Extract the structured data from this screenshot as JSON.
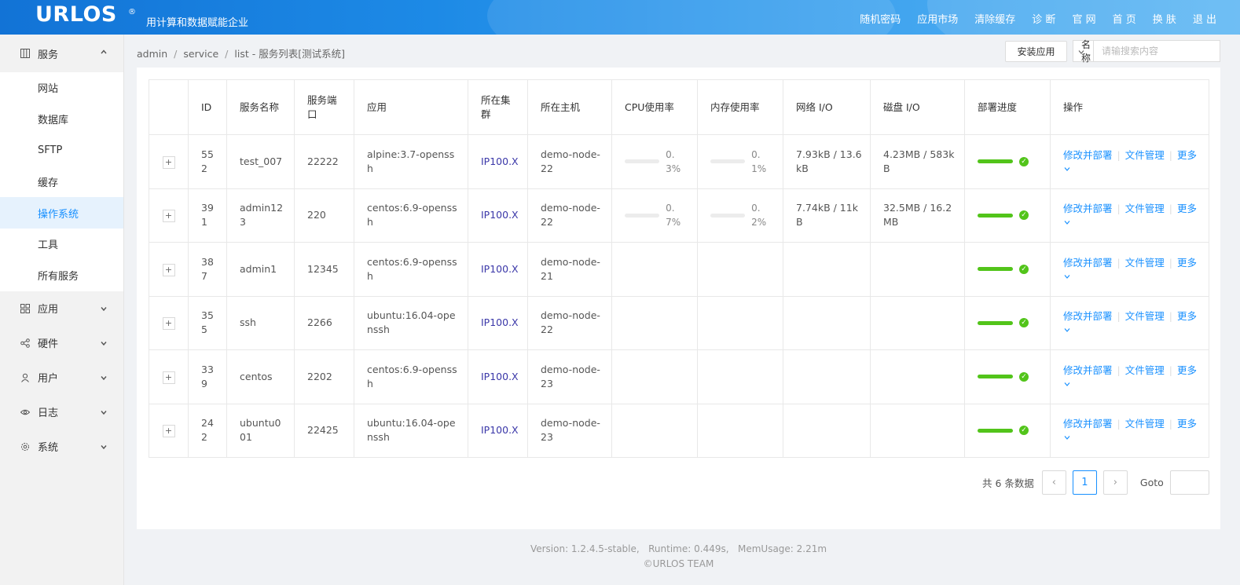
{
  "header": {
    "logo": "URLOS",
    "logo_mark": "®",
    "slogan": "用计算和数据赋能企业",
    "nav": [
      "随机密码",
      "应用市场",
      "清除缓存",
      "诊 断",
      "官 网",
      "首 页",
      "换 肤",
      "退 出"
    ]
  },
  "sidebar": {
    "groups": [
      {
        "label": "服务",
        "icon": "grid-icon",
        "expanded": true,
        "items": [
          "网站",
          "数据库",
          "SFTP",
          "缓存",
          "操作系统",
          "工具",
          "所有服务"
        ],
        "active_item": "操作系统"
      },
      {
        "label": "应用",
        "icon": "apps-icon",
        "expanded": false
      },
      {
        "label": "硬件",
        "icon": "share-icon",
        "expanded": false
      },
      {
        "label": "用户",
        "icon": "user-icon",
        "expanded": false
      },
      {
        "label": "日志",
        "icon": "eye-icon",
        "expanded": false
      },
      {
        "label": "系统",
        "icon": "gear-icon",
        "expanded": false
      }
    ]
  },
  "breadcrumb": {
    "parts": [
      "admin",
      "service",
      "list"
    ],
    "tail": "服务列表[测试系统]"
  },
  "toolbar": {
    "install_label": "安装应用",
    "search_field": "名称",
    "search_placeholder": "请输搜索内容"
  },
  "table": {
    "columns": [
      "ID",
      "服务名称",
      "服务端口",
      "应用",
      "所在集群",
      "所在主机",
      "CPU使用率",
      "内存使用率",
      "网络 I/O",
      "磁盘 I/O",
      "部署进度",
      "操作"
    ],
    "rows": [
      {
        "id": "552",
        "name": "test_007",
        "port": "22222",
        "app": "alpine:3.7-openssh",
        "cluster": "IP100.X",
        "host": "demo-node-22",
        "cpu": "0.3%",
        "mem": "0.1%",
        "net": "7.93kB / 13.6kB",
        "disk": "4.23MB / 583kB",
        "deploy_progress": 1.0
      },
      {
        "id": "391",
        "name": "admin123",
        "port": "220",
        "app": "centos:6.9-openssh",
        "cluster": "IP100.X",
        "host": "demo-node-22",
        "cpu": "0.7%",
        "mem": "0.2%",
        "net": "7.74kB / 11kB",
        "disk": "32.5MB / 16.2MB",
        "deploy_progress": 1.0
      },
      {
        "id": "387",
        "name": "admin1",
        "port": "12345",
        "app": "centos:6.9-openssh",
        "cluster": "IP100.X",
        "host": "demo-node-21",
        "cpu": "",
        "mem": "",
        "net": "",
        "disk": "",
        "deploy_progress": 1.0
      },
      {
        "id": "355",
        "name": "ssh",
        "port": "2266",
        "app": "ubuntu:16.04-openssh",
        "cluster": "IP100.X",
        "host": "demo-node-22",
        "cpu": "",
        "mem": "",
        "net": "",
        "disk": "",
        "deploy_progress": 1.0
      },
      {
        "id": "339",
        "name": "centos",
        "port": "2202",
        "app": "centos:6.9-openssh",
        "cluster": "IP100.X",
        "host": "demo-node-23",
        "cpu": "",
        "mem": "",
        "net": "",
        "disk": "",
        "deploy_progress": 1.0
      },
      {
        "id": "242",
        "name": "ubuntu001",
        "port": "22425",
        "app": "ubuntu:16.04-openssh",
        "cluster": "IP100.X",
        "host": "demo-node-23",
        "cpu": "",
        "mem": "",
        "net": "",
        "disk": "",
        "deploy_progress": 1.0
      }
    ],
    "row_actions": [
      "修改并部署",
      "文件管理",
      "更多"
    ],
    "expand_symbol": "+"
  },
  "pagination": {
    "total_text": "共 6 条数据",
    "current_page": "1",
    "prev": "‹",
    "next": "›",
    "goto_label": "Goto"
  },
  "footer": {
    "line1": "Version: 1.2.4.5-stable,   Runtime: 0.449s,   MemUsage: 2.21m",
    "line2": "©URLOS TEAM"
  },
  "colors": {
    "header": "#1d8ae6",
    "link": "#1890ff",
    "cluster": "#3a37a8",
    "success": "#52c41a",
    "active_bg": "#e6f2fd"
  }
}
